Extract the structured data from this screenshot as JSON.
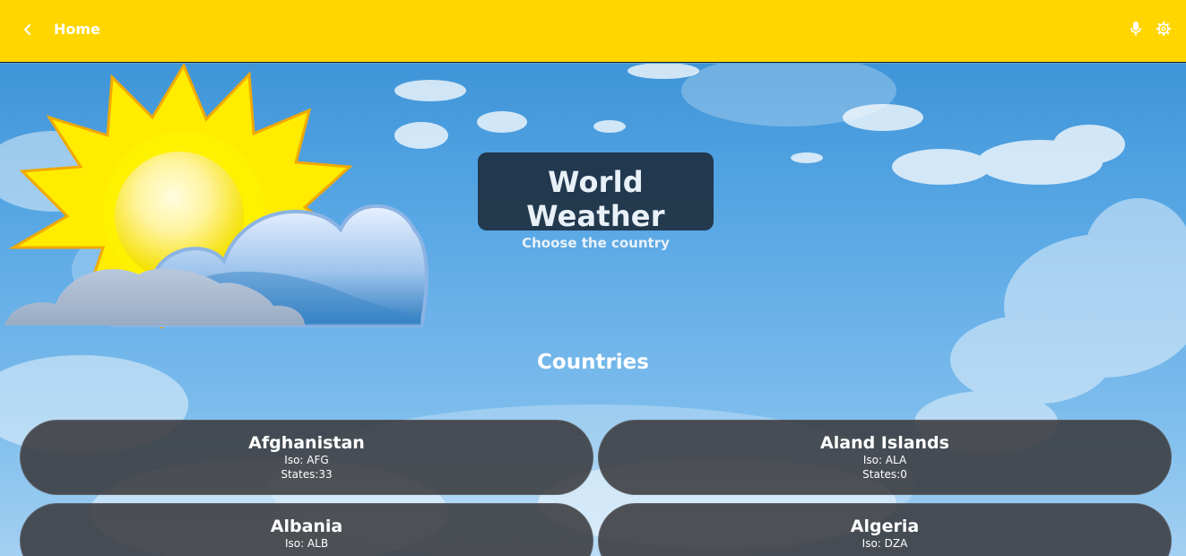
{
  "topbar": {
    "title": "Home",
    "background": "#ffd600",
    "icons": {
      "back": "chevron-left-icon",
      "mic": "mic-icon",
      "settings": "gear-icon"
    }
  },
  "hero": {
    "title": "World Weather",
    "subtitle": "Choose the country"
  },
  "section": {
    "title": "Countries"
  },
  "countries": [
    {
      "name": "Afghanistan",
      "iso": "Iso: AFG",
      "states": "States:33"
    },
    {
      "name": "Aland Islands",
      "iso": "Iso: ALA",
      "states": "States:0"
    },
    {
      "name": "Albania",
      "iso": "Iso: ALB",
      "states": ""
    },
    {
      "name": "Algeria",
      "iso": "Iso: DZA",
      "states": ""
    }
  ]
}
